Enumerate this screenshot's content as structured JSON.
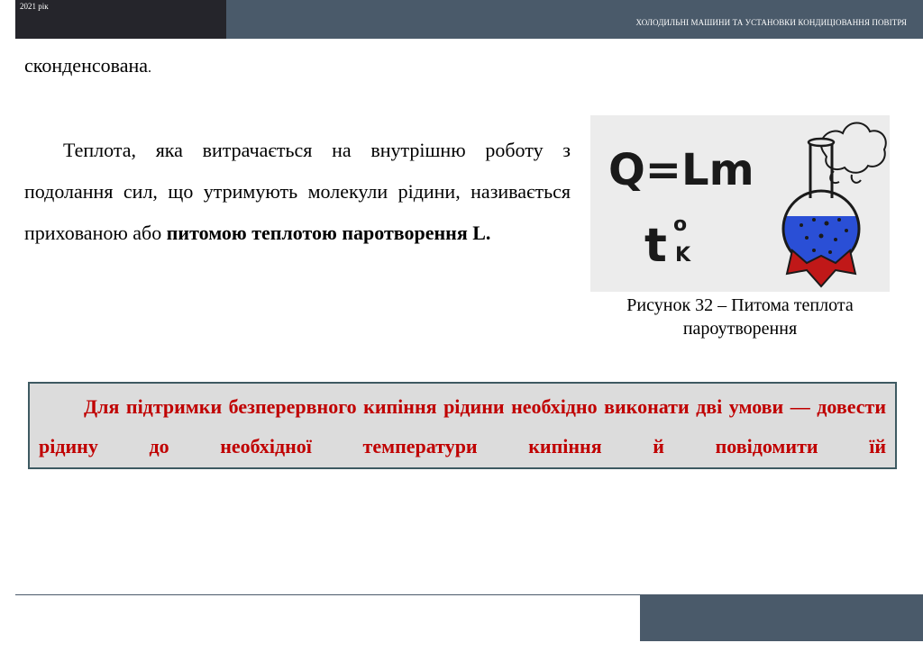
{
  "header": {
    "year": "2021 рік",
    "title": "ХОЛОДИЛЬНІ МАШИНИ ТА УСТАНОВКИ КОНДИЦІОВАННЯ ПОВІТРЯ"
  },
  "body": {
    "top_word": "сконденсована",
    "top_word_end": ".",
    "paragraph_normal": "Теплота, яка витрачається на внутрішню роботу з подолання сил, що утримують молекули рідини, називається прихованою або ",
    "paragraph_bold": "питомою теплотою паротворення L."
  },
  "figure": {
    "formula_main": "Q=Lm",
    "formula_t": "t",
    "formula_sup": "o",
    "formula_sub": "K",
    "caption": "Рисунок 32 – Питома теплота пароутворення",
    "colors": {
      "liquid": "#2a4fd6",
      "holder": "#c01818",
      "ink": "#1a1a1a",
      "background": "#ececec"
    }
  },
  "note": {
    "text": "Для підтримки безперервного кипіння рідини необхідно виконати дві умови — довести рідину до необхідної температури кипіння й повідомити їй"
  },
  "colors": {
    "header_dark": "#25252b",
    "header_slate": "#4a5a6a",
    "note_bg": "#dcdcdc",
    "note_border": "#3e5a62",
    "note_text": "#c00000"
  }
}
